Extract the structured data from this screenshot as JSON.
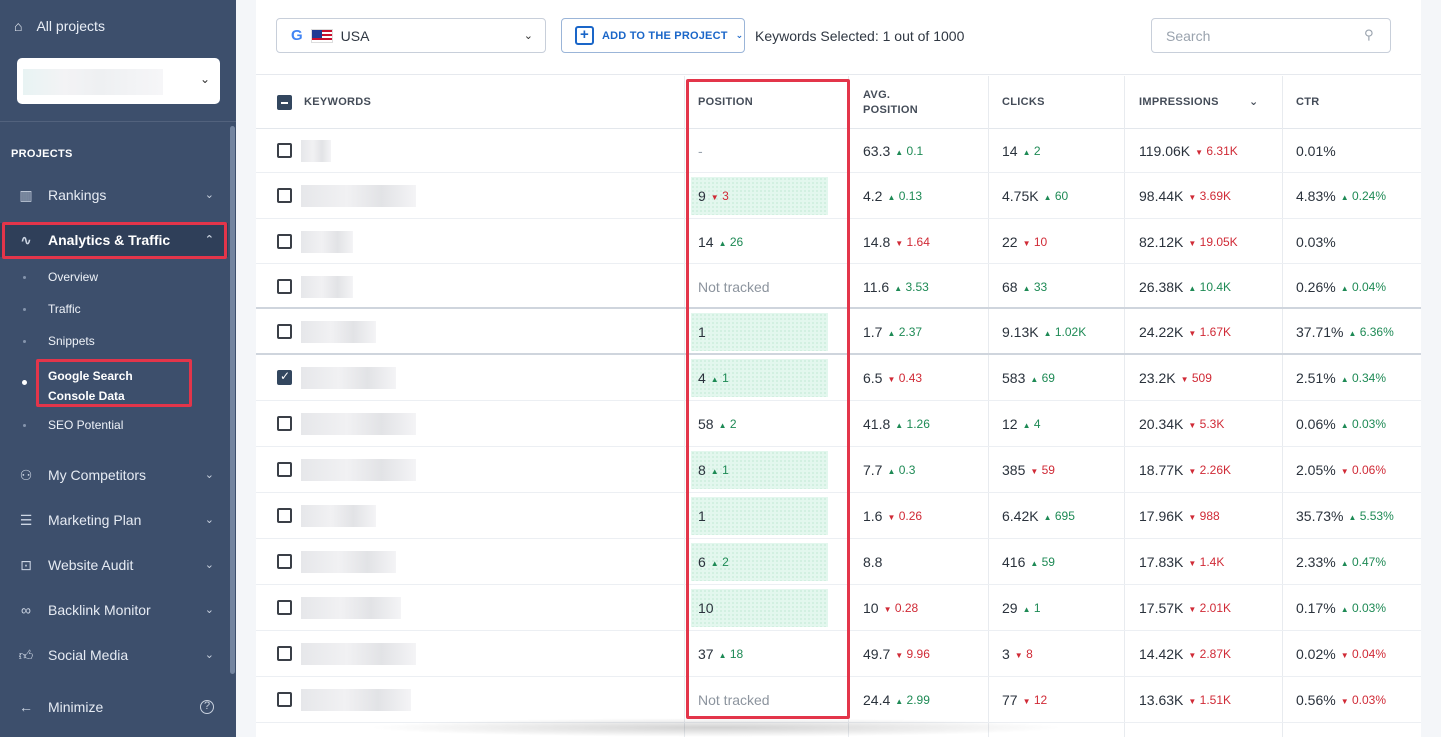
{
  "sidebar": {
    "all_projects": "All projects",
    "section_label": "PROJECTS",
    "items": [
      {
        "label": "Rankings"
      },
      {
        "label": "Analytics & Traffic"
      },
      {
        "label": "My Competitors"
      },
      {
        "label": "Marketing Plan"
      },
      {
        "label": "Website Audit"
      },
      {
        "label": "Backlink Monitor"
      },
      {
        "label": "Social Media"
      }
    ],
    "subitems": [
      {
        "label": "Overview"
      },
      {
        "label": "Traffic"
      },
      {
        "label": "Snippets"
      },
      {
        "label": "Google Search Console Data"
      },
      {
        "label": "SEO Potential"
      }
    ],
    "minimize": "Minimize",
    "help_icon": "?"
  },
  "toolbar": {
    "country": "USA",
    "add_to_project": "ADD TO THE PROJECT",
    "keywords_selected": "Keywords Selected: 1 out of 1000",
    "search_placeholder": "Search"
  },
  "table": {
    "headers": {
      "keywords": "KEYWORDS",
      "position": "POSITION",
      "avg_position": "AVG. POSITION",
      "clicks": "CLICKS",
      "impressions": "IMPRESSIONS",
      "ctr": "CTR"
    },
    "rows": [
      {
        "position": "-",
        "pos_delta": "",
        "pos_dir": "",
        "avg": "63.3",
        "avg_delta": "0.1",
        "avg_dir": "up",
        "clicks": "14",
        "clicks_delta": "2",
        "clicks_dir": "up",
        "imp": "119.06K",
        "imp_delta": "6.31K",
        "imp_dir": "down",
        "ctr": "0.01%",
        "ctr_delta": "",
        "ctr_dir": ""
      },
      {
        "position": "9",
        "pos_delta": "3",
        "pos_dir": "down",
        "avg": "4.2",
        "avg_delta": "0.13",
        "avg_dir": "up",
        "clicks": "4.75K",
        "clicks_delta": "60",
        "clicks_dir": "up",
        "imp": "98.44K",
        "imp_delta": "3.69K",
        "imp_dir": "down",
        "ctr": "4.83%",
        "ctr_delta": "0.24%",
        "ctr_dir": "up"
      },
      {
        "position": "14",
        "pos_delta": "26",
        "pos_dir": "up",
        "avg": "14.8",
        "avg_delta": "1.64",
        "avg_dir": "down",
        "clicks": "22",
        "clicks_delta": "10",
        "clicks_dir": "down",
        "imp": "82.12K",
        "imp_delta": "19.05K",
        "imp_dir": "down",
        "ctr": "0.03%",
        "ctr_delta": "",
        "ctr_dir": ""
      },
      {
        "position": "Not tracked",
        "pos_delta": "",
        "pos_dir": "",
        "avg": "11.6",
        "avg_delta": "3.53",
        "avg_dir": "up",
        "clicks": "68",
        "clicks_delta": "33",
        "clicks_dir": "up",
        "imp": "26.38K",
        "imp_delta": "10.4K",
        "imp_dir": "up",
        "ctr": "0.26%",
        "ctr_delta": "0.04%",
        "ctr_dir": "up"
      },
      {
        "position": "1",
        "pos_delta": "",
        "pos_dir": "",
        "avg": "1.7",
        "avg_delta": "2.37",
        "avg_dir": "up",
        "clicks": "9.13K",
        "clicks_delta": "1.02K",
        "clicks_dir": "up",
        "imp": "24.22K",
        "imp_delta": "1.67K",
        "imp_dir": "down",
        "ctr": "37.71%",
        "ctr_delta": "6.36%",
        "ctr_dir": "up"
      },
      {
        "position": "4",
        "pos_delta": "1",
        "pos_dir": "up",
        "avg": "6.5",
        "avg_delta": "0.43",
        "avg_dir": "down",
        "clicks": "583",
        "clicks_delta": "69",
        "clicks_dir": "up",
        "imp": "23.2K",
        "imp_delta": "509",
        "imp_dir": "down",
        "ctr": "2.51%",
        "ctr_delta": "0.34%",
        "ctr_dir": "up"
      },
      {
        "position": "58",
        "pos_delta": "2",
        "pos_dir": "up",
        "avg": "41.8",
        "avg_delta": "1.26",
        "avg_dir": "up",
        "clicks": "12",
        "clicks_delta": "4",
        "clicks_dir": "up",
        "imp": "20.34K",
        "imp_delta": "5.3K",
        "imp_dir": "down",
        "ctr": "0.06%",
        "ctr_delta": "0.03%",
        "ctr_dir": "up"
      },
      {
        "position": "8",
        "pos_delta": "1",
        "pos_dir": "up",
        "avg": "7.7",
        "avg_delta": "0.3",
        "avg_dir": "up",
        "clicks": "385",
        "clicks_delta": "59",
        "clicks_dir": "down",
        "imp": "18.77K",
        "imp_delta": "2.26K",
        "imp_dir": "down",
        "ctr": "2.05%",
        "ctr_delta": "0.06%",
        "ctr_dir": "down"
      },
      {
        "position": "1",
        "pos_delta": "",
        "pos_dir": "",
        "avg": "1.6",
        "avg_delta": "0.26",
        "avg_dir": "down",
        "clicks": "6.42K",
        "clicks_delta": "695",
        "clicks_dir": "up",
        "imp": "17.96K",
        "imp_delta": "988",
        "imp_dir": "down",
        "ctr": "35.73%",
        "ctr_delta": "5.53%",
        "ctr_dir": "up"
      },
      {
        "position": "6",
        "pos_delta": "2",
        "pos_dir": "up",
        "avg": "8.8",
        "avg_delta": "",
        "avg_dir": "",
        "clicks": "416",
        "clicks_delta": "59",
        "clicks_dir": "up",
        "imp": "17.83K",
        "imp_delta": "1.4K",
        "imp_dir": "down",
        "ctr": "2.33%",
        "ctr_delta": "0.47%",
        "ctr_dir": "up"
      },
      {
        "position": "10",
        "pos_delta": "",
        "pos_dir": "",
        "avg": "10",
        "avg_delta": "0.28",
        "avg_dir": "down",
        "clicks": "29",
        "clicks_delta": "1",
        "clicks_dir": "up",
        "imp": "17.57K",
        "imp_delta": "2.01K",
        "imp_dir": "down",
        "ctr": "0.17%",
        "ctr_delta": "0.03%",
        "ctr_dir": "up"
      },
      {
        "position": "37",
        "pos_delta": "18",
        "pos_dir": "up",
        "avg": "49.7",
        "avg_delta": "9.96",
        "avg_dir": "down",
        "clicks": "3",
        "clicks_delta": "8",
        "clicks_dir": "down",
        "imp": "14.42K",
        "imp_delta": "2.87K",
        "imp_dir": "down",
        "ctr": "0.02%",
        "ctr_delta": "0.04%",
        "ctr_dir": "down"
      },
      {
        "position": "Not tracked",
        "pos_delta": "",
        "pos_dir": "",
        "avg": "24.4",
        "avg_delta": "2.99",
        "avg_dir": "up",
        "clicks": "77",
        "clicks_delta": "12",
        "clicks_dir": "down",
        "imp": "13.63K",
        "imp_delta": "1.51K",
        "imp_dir": "down",
        "ctr": "0.56%",
        "ctr_delta": "0.03%",
        "ctr_dir": "down"
      }
    ]
  },
  "colors": {
    "sidebar_bg": "#3d4f6c",
    "highlight": "#e3354a",
    "up": "#1e8a55",
    "down": "#d02a36",
    "accent": "#1a66c8"
  }
}
